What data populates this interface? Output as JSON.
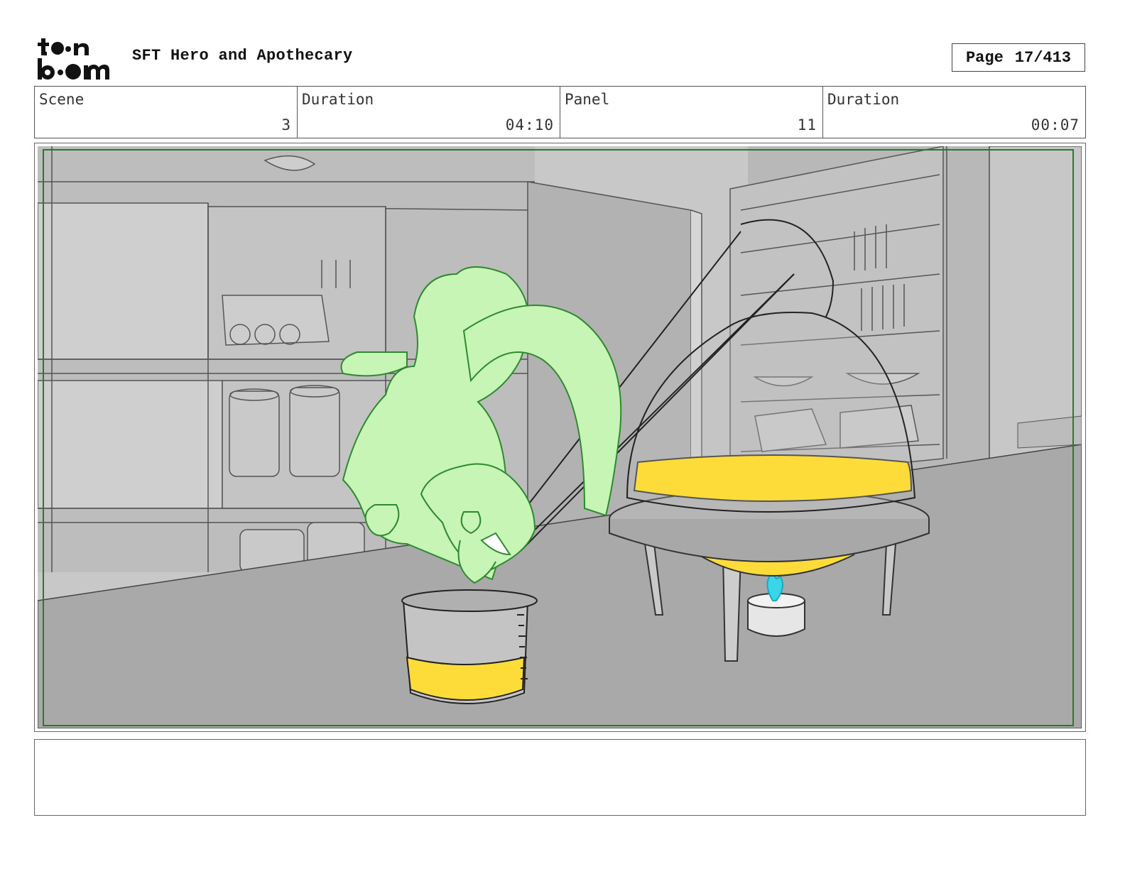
{
  "header": {
    "logo_alt": "toon boom",
    "title": "SFT Hero and Apothecary",
    "page_label": "Page",
    "page_number": "17/413"
  },
  "info": {
    "scene_label": "Scene",
    "scene_value": "3",
    "scene_duration_label": "Duration",
    "scene_duration_value": "04:10",
    "panel_label": "Panel",
    "panel_value": "11",
    "panel_duration_label": "Duration",
    "panel_duration_value": "00:07"
  },
  "notes": {
    "text": ""
  },
  "colors": {
    "character_fill": "#c6f5b6",
    "character_line": "#2e8a2e",
    "liquid": "#fddc3a",
    "flame": "#39d6e8",
    "background_gray": "#c9c9c9",
    "table_gray": "#aaaaaa",
    "frame_green": "#2a7a2a"
  }
}
